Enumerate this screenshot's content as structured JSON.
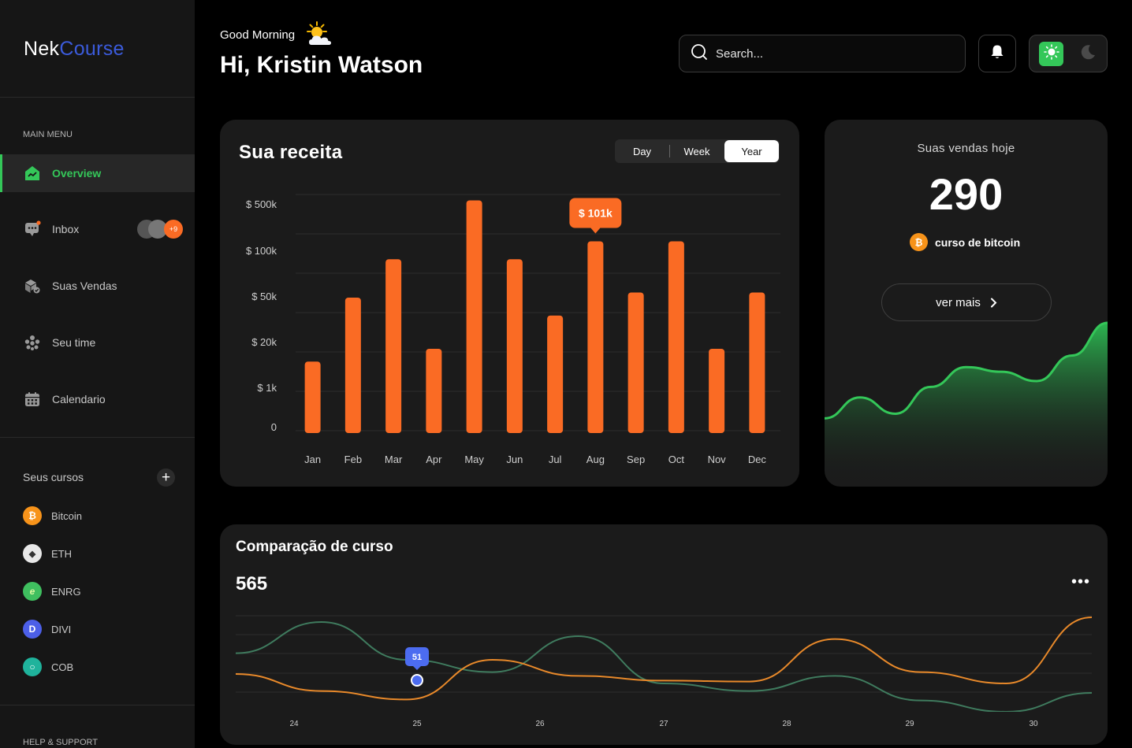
{
  "brand": {
    "part1": "Nek",
    "part2": "Course"
  },
  "sidebar": {
    "menu_title": "MAIN MENU",
    "items": [
      {
        "label": "Overview",
        "icon": "chart-home-icon",
        "active": true
      },
      {
        "label": "Inbox",
        "icon": "chat-icon",
        "badge": "+9"
      },
      {
        "label": "Suas Vendas",
        "icon": "boxes-icon"
      },
      {
        "label": "Seu time",
        "icon": "team-icon"
      },
      {
        "label": "Calendario",
        "icon": "calendar-icon"
      }
    ],
    "courses_title": "Seus cursos",
    "courses": [
      {
        "label": "Bitcoin",
        "symbol": "₿",
        "color": "#f7931a"
      },
      {
        "label": "ETH",
        "symbol": "◆",
        "color": "#e8e8e8"
      },
      {
        "label": "ENRG",
        "symbol": "e",
        "color": "#3fbf5f"
      },
      {
        "label": "DIVI",
        "symbol": "D",
        "color": "#4c5fe8"
      },
      {
        "label": "COB",
        "symbol": "○",
        "color": "#1fb39c"
      }
    ],
    "help": "HELP & SUPPORT"
  },
  "header": {
    "greeting": "Good Morning",
    "name": "Hi, Kristin Watson",
    "search_placeholder": "Search..."
  },
  "revenue": {
    "title": "Sua receita",
    "periods": [
      "Day",
      "Week",
      "Year"
    ],
    "selected_period": "Year",
    "tooltip": "$ 101k",
    "bar_color": "#fa6b24"
  },
  "sales_today": {
    "title": "Suas vendas hoje",
    "value": "290",
    "course": "curso de bitcoin",
    "button": "ver mais",
    "accent": "#34c759"
  },
  "comparison": {
    "title": "Comparação de curso",
    "value": "565",
    "marker_label": "51"
  },
  "chart_data": [
    {
      "type": "bar",
      "title": "Sua receita",
      "categories": [
        "Jan",
        "Feb",
        "Mar",
        "Apr",
        "May",
        "Jun",
        "Jul",
        "Aug",
        "Sep",
        "Oct",
        "Nov",
        "Dec"
      ],
      "y_ticks": [
        "0",
        "$ 1k",
        "$ 20k",
        "$ 50k",
        "$ 100k",
        "$ 500k"
      ],
      "values": [
        0.27,
        0.52,
        0.67,
        0.32,
        0.9,
        0.67,
        0.45,
        0.74,
        0.54,
        0.74,
        0.32,
        0.54
      ],
      "value_unit": "fraction of axis height (non-linear tick scale)",
      "highlight": {
        "category": "Aug",
        "label": "$ 101k"
      }
    },
    {
      "type": "area",
      "title": "Suas vendas hoje",
      "points": [
        0.18,
        0.36,
        0.22,
        0.45,
        0.62,
        0.58,
        0.5,
        0.72,
        1.0
      ]
    },
    {
      "type": "line",
      "title": "Comparação de curso",
      "categories": [
        "24",
        "25",
        "26",
        "27",
        "28",
        "29",
        "30"
      ],
      "series": [
        {
          "color": "#3f7b5e",
          "values": [
            0.62,
            0.95,
            0.55,
            0.42,
            0.8,
            0.3,
            0.22,
            0.38,
            0.12,
            0.0,
            0.2
          ]
        },
        {
          "color": "#e8892a",
          "values": [
            0.4,
            0.22,
            0.13,
            0.55,
            0.38,
            0.33,
            0.32,
            0.77,
            0.42,
            0.3,
            1.0
          ]
        }
      ],
      "highlight": {
        "category": "25",
        "label": "51"
      }
    }
  ]
}
